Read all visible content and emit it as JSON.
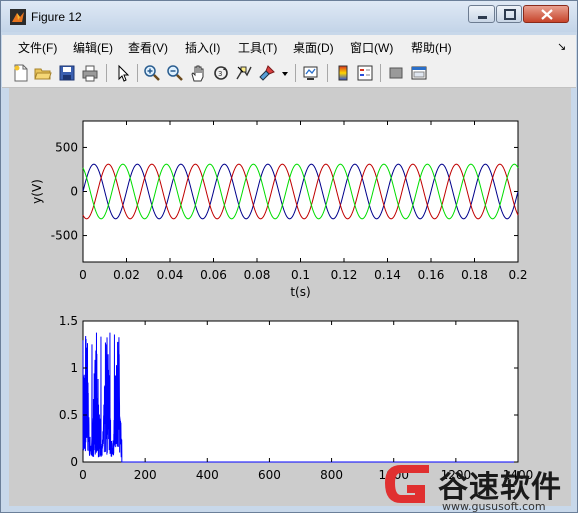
{
  "window": {
    "title": "Figure 12",
    "colors": {
      "titlebar": "#c3d4e8",
      "figure_bg": "#cccccc",
      "close": "#c7442b"
    }
  },
  "menu": {
    "items": [
      "文件(F)",
      "编辑(E)",
      "查看(V)",
      "插入(I)",
      "工具(T)",
      "桌面(D)",
      "窗口(W)",
      "帮助(H)"
    ],
    "overflow_icon": "chevron-icon"
  },
  "toolbar": {
    "icons": [
      "new-figure-icon",
      "open-file-icon",
      "save-icon",
      "print-icon",
      "edit-plot-arrow-icon",
      "zoom-in-icon",
      "zoom-out-icon",
      "pan-hand-icon",
      "rotate-3d-icon",
      "data-cursor-icon",
      "brush-icon",
      "dropdown-arrow-icon",
      "link-plot-icon",
      "insert-colorbar-icon",
      "insert-legend-icon",
      "hide-plot-tools-icon",
      "show-plot-tools-icon"
    ]
  },
  "watermark": {
    "text": "谷速软件",
    "url": "www.gususoft.com",
    "color": "#e03030"
  },
  "chart_data": [
    {
      "type": "line",
      "xlabel": "t(s)",
      "ylabel": "y(V)",
      "xlim": [
        0,
        0.2
      ],
      "ylim": [
        -800,
        800
      ],
      "xticks": [
        0,
        0.02,
        0.04,
        0.06,
        0.08,
        0.1,
        0.12,
        0.14,
        0.16,
        0.18,
        0.2
      ],
      "yticks": [
        500,
        0,
        -500
      ],
      "xtick_labels": [
        "0",
        "0.02",
        "0.04",
        "0.06",
        "0.08",
        "0.1",
        "0.12",
        "0.14",
        "0.16",
        "0.18",
        "0.2"
      ],
      "ytick_labels": [
        "500",
        "0",
        "-500"
      ],
      "grid": false,
      "series": [
        {
          "amplitude": 310,
          "frequency_hz": 50,
          "phase_deg": 0,
          "color": "#00008b"
        },
        {
          "amplitude": 310,
          "frequency_hz": 50,
          "phase_deg": -120,
          "color": "#c00000"
        },
        {
          "amplitude": 310,
          "frequency_hz": 50,
          "phase_deg": 120,
          "color": "#00dd00"
        }
      ]
    },
    {
      "type": "line",
      "xlabel": "",
      "ylabel": "",
      "xlim": [
        0,
        1400
      ],
      "ylim": [
        0,
        1.5
      ],
      "xticks": [
        0,
        200,
        400,
        600,
        800,
        1000,
        1200,
        1400
      ],
      "yticks": [
        1.5,
        1,
        0.5,
        0
      ],
      "xtick_labels": [
        "0",
        "200",
        "400",
        "600",
        "800",
        "1000",
        "1200",
        "1400"
      ],
      "ytick_labels": [
        "1.5",
        "1",
        "0.5",
        "0"
      ],
      "grid": false,
      "series": [
        {
          "color": "#0000ff",
          "x_range": [
            0,
            125
          ],
          "y_range": [
            0.05,
            1.38
          ],
          "after_x": 125,
          "after_y": 0
        }
      ]
    }
  ]
}
